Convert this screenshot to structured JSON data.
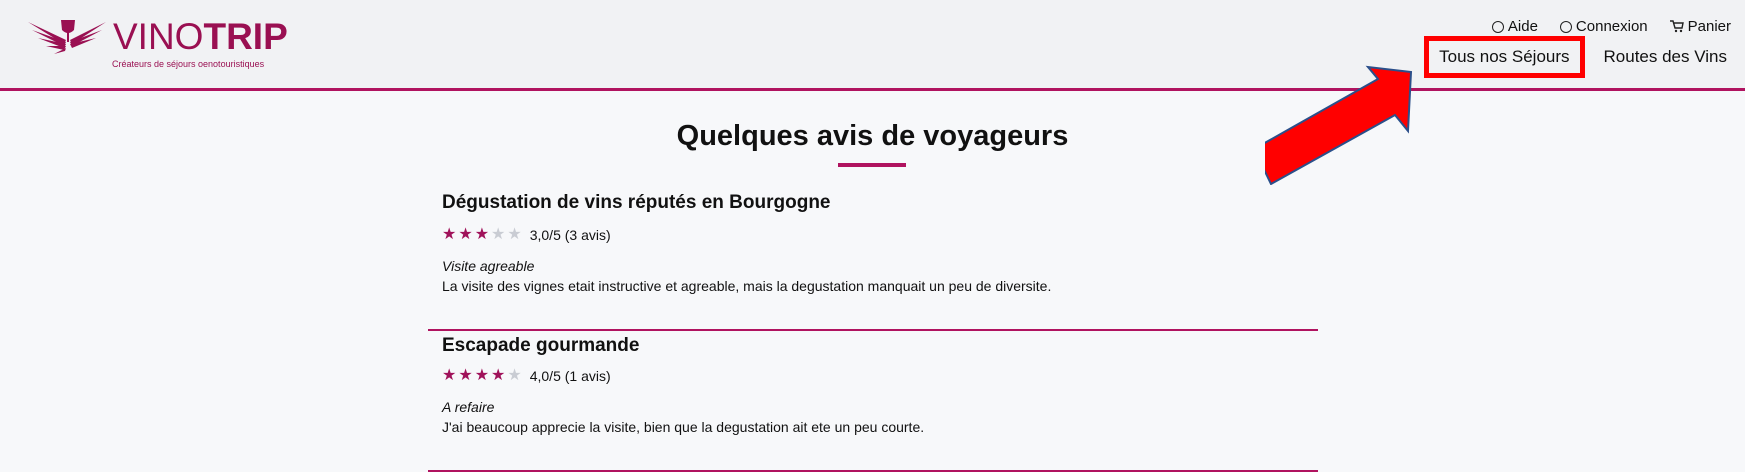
{
  "brand": {
    "name_thin": "VINO",
    "name_bold": "TRIP",
    "tagline": "Créateurs de séjours oenotouristiques",
    "color": "#9a1052"
  },
  "utility_nav": [
    {
      "label": "Aide",
      "icon": "help-icon"
    },
    {
      "label": "Connexion",
      "icon": "user-icon"
    },
    {
      "label": "Panier",
      "icon": "cart-icon"
    }
  ],
  "main_nav": [
    {
      "label": "Tous nos Séjours",
      "highlighted": true
    },
    {
      "label": "Routes des Vins",
      "highlighted": false
    }
  ],
  "page": {
    "title": "Quelques avis de voyageurs",
    "accent": "#b0135f"
  },
  "reviews": [
    {
      "title": "Dégustation de vins réputés en Bourgogne",
      "stars": 3,
      "rating_text": "3,0/5 (3 avis)",
      "headline": "Visite agreable",
      "text": "La visite des vignes etait instructive et agreable, mais la degustation manquait un peu de diversite."
    },
    {
      "title": "Escapade gourmande",
      "stars": 4,
      "rating_text": "4,0/5 (1 avis)",
      "headline": "A refaire",
      "text": "J'ai beaucoup apprecie la visite, bien que la degustation ait ete un peu courte."
    }
  ],
  "annotation": {
    "arrow_color": "#ff0000",
    "box_color": "#ff0000"
  }
}
